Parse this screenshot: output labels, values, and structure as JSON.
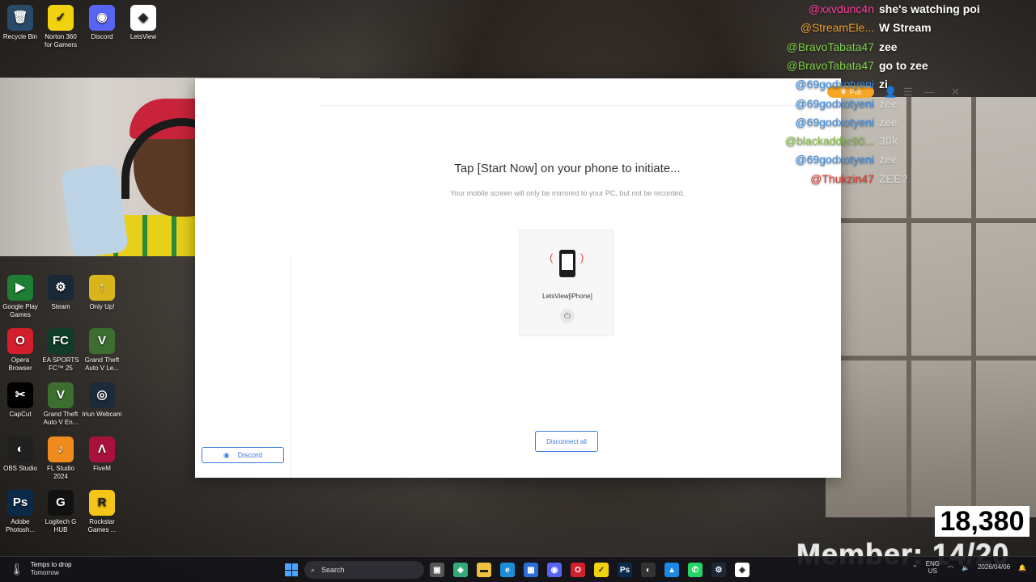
{
  "desktop_icons": [
    {
      "label": "Recycle Bin",
      "icon": "recycle-bin-icon",
      "glyph": "🗑",
      "bg": "#2a4a6a"
    },
    {
      "label": "Norton 360 for Gamers",
      "icon": "norton-icon",
      "glyph": "✓",
      "bg": "#f2d20f"
    },
    {
      "label": "Discord",
      "icon": "discord-icon",
      "glyph": "◉",
      "bg": "#5865f2"
    },
    {
      "label": "LetsView",
      "icon": "letsview-icon",
      "glyph": "◈",
      "bg": "#ffffff"
    },
    {
      "label": "Google Play Games",
      "icon": "google-play-games-icon",
      "glyph": "▶",
      "bg": "#1e7e34"
    },
    {
      "label": "Steam",
      "icon": "steam-icon",
      "glyph": "⚙",
      "bg": "#1b2838"
    },
    {
      "label": "Only Up!",
      "icon": "only-up-icon",
      "glyph": "↑",
      "bg": "#d9b51c"
    },
    {
      "label": "Opera Browser",
      "icon": "opera-icon",
      "glyph": "O",
      "bg": "#d21f2b"
    },
    {
      "label": "EA SPORTS FC™ 25",
      "icon": "ea-fc-icon",
      "glyph": "FC",
      "bg": "#0f3d2a"
    },
    {
      "label": "Grand Theft Auto V Le...",
      "icon": "gta-icon",
      "glyph": "V",
      "bg": "#3c6e2f"
    },
    {
      "label": "CapCut",
      "icon": "capcut-icon",
      "glyph": "✂",
      "bg": "#000000"
    },
    {
      "label": "Grand Theft Auto V En...",
      "icon": "gta-enhanced-icon",
      "glyph": "V",
      "bg": "#3c6e2f"
    },
    {
      "label": "Iriun Webcam",
      "icon": "iriun-webcam-icon",
      "glyph": "◎",
      "bg": "#1c2a3a"
    },
    {
      "label": "OBS Studio",
      "icon": "obs-icon",
      "glyph": "◐",
      "bg": "#202020"
    },
    {
      "label": "FL Studio 2024",
      "icon": "fl-studio-icon",
      "glyph": "♪",
      "bg": "#f08c1e"
    },
    {
      "label": "FiveM",
      "icon": "fivem-icon",
      "glyph": "Λ",
      "bg": "#a8123a"
    },
    {
      "label": "Adobe Photosh...",
      "icon": "photoshop-icon",
      "glyph": "Ps",
      "bg": "#0b2a4a"
    },
    {
      "label": "Logitech G HUB",
      "icon": "logitech-icon",
      "glyph": "G",
      "bg": "#111111"
    },
    {
      "label": "Rockstar Games ...",
      "icon": "rockstar-icon",
      "glyph": "R",
      "bg": "#f5c518"
    }
  ],
  "app": {
    "pro_label": "Pro",
    "title": "Tap [Start Now] on your phone to initiate...",
    "subtitle": "Your mobile screen will only be mirrored to your PC, but not be recorded.",
    "device_name": "LetsView[iPhone]",
    "disconnect_label": "Disconnect all",
    "discord_label": "Discord",
    "brand_color": "#3d7be0",
    "pro_color": "#f5a623"
  },
  "chat": [
    {
      "user": "@xxvdunc4n",
      "msg": "she's watching poi",
      "color": "#ff3fa0"
    },
    {
      "user": "@StreamEle...",
      "msg": "W Stream",
      "color": "#f0a030"
    },
    {
      "user": "@BravoTabata47",
      "msg": "zee",
      "color": "#7ed14a"
    },
    {
      "user": "@BravoTabata47",
      "msg": "go to zee",
      "color": "#7ed14a"
    },
    {
      "user": "@69godxotyeni",
      "msg": "zi",
      "color": "#3d8fe0"
    },
    {
      "user": "@69godxotyeni",
      "msg": "zee",
      "color": "#3d8fe0"
    },
    {
      "user": "@69godxotyeni",
      "msg": "zee",
      "color": "#3d8fe0"
    },
    {
      "user": "@blackadder90...",
      "msg": "30k",
      "color": "#8bc34a"
    },
    {
      "user": "@69godxotyeni",
      "msg": "zee",
      "color": "#3d8fe0"
    },
    {
      "user": "@Thukzin47",
      "msg": "ZEE?",
      "color": "#e53a2a"
    }
  ],
  "counter": {
    "viewers": "18,380",
    "members": "Member: 14/20"
  },
  "taskbar": {
    "weather_line1": "Temps to drop",
    "weather_line2": "Tomorrow",
    "search_placeholder": "Search",
    "lang_top": "ENG",
    "lang_bottom": "US",
    "time": "",
    "date": "2026/04/06",
    "apps": [
      {
        "name": "task-view-icon",
        "glyph": "▣",
        "bg": "#555"
      },
      {
        "name": "widgets-icon",
        "glyph": "◆",
        "bg": "#3a7"
      },
      {
        "name": "file-explorer-icon",
        "glyph": "▬",
        "bg": "#f0c040"
      },
      {
        "name": "edge-icon",
        "glyph": "e",
        "bg": "#1a8fd6"
      },
      {
        "name": "store-icon",
        "glyph": "▦",
        "bg": "#2b6cd6"
      },
      {
        "name": "discord-taskbar-icon",
        "glyph": "◉",
        "bg": "#5865f2"
      },
      {
        "name": "opera-taskbar-icon",
        "glyph": "O",
        "bg": "#d21f2b"
      },
      {
        "name": "norton-taskbar-icon",
        "glyph": "✓",
        "bg": "#f2d20f"
      },
      {
        "name": "photoshop-taskbar-icon",
        "glyph": "Ps",
        "bg": "#0b2a4a"
      },
      {
        "name": "obs-taskbar-icon",
        "glyph": "◐",
        "bg": "#333"
      },
      {
        "name": "photos-icon",
        "glyph": "▲",
        "bg": "#1e88e5"
      },
      {
        "name": "whatsapp-icon",
        "glyph": "✆",
        "bg": "#25d366"
      },
      {
        "name": "steam-taskbar-icon",
        "glyph": "⚙",
        "bg": "#1b2838"
      },
      {
        "name": "letsview-taskbar-icon",
        "glyph": "◈",
        "bg": "#fff"
      }
    ]
  }
}
